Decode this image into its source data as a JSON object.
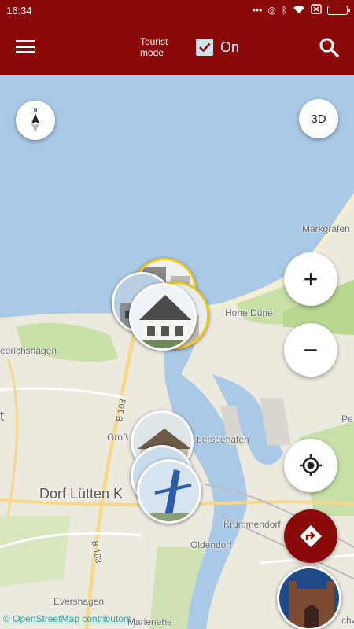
{
  "status_bar": {
    "time": "16:34",
    "icons": [
      "more-icon",
      "data-saver-icon",
      "bluetooth-icon",
      "wifi-icon",
      "sim-icon",
      "battery-icon"
    ]
  },
  "app_bar": {
    "menu_icon": "hamburger-menu-icon",
    "tourist_mode_label_line1": "Tourist",
    "tourist_mode_label_line2": "mode",
    "tourist_mode_checked": true,
    "tourist_mode_state": "On",
    "search_icon": "search-icon",
    "background_color": "#8a0a0a"
  },
  "map": {
    "labels": {
      "markgrafen": "Markgrafen",
      "hohe_dune": "Hohe Düne",
      "friedrichshagen": "edrichshagen",
      "left_t": "t",
      "gross": "Groß",
      "ueberseehafen": "berseehafen",
      "pe": "Pe",
      "dorf_lutten": "Dorf Lütten K",
      "krummendorf": "Krummendorf",
      "oldendorf": "Oldendorf",
      "evershagen": "Evershagen",
      "marienehe": "Marienehe",
      "schw": "chwi",
      "road_b103_a": "B 103",
      "road_b103_b": "B 103"
    },
    "attribution": "© OpenStreetMap contributors",
    "water_color": "#a9c9e6",
    "land_color": "#ece9df",
    "green_color": "#c9dfa8"
  },
  "controls": {
    "compass_label": "N",
    "view_3d_label": "3D",
    "zoom_in_label": "+",
    "zoom_out_label": "−",
    "locate_icon": "my-location-icon",
    "directions_icon": "directions-icon"
  }
}
